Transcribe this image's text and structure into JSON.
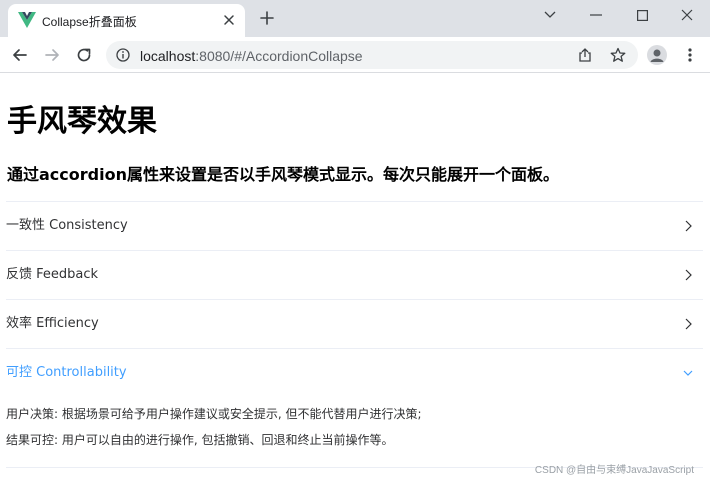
{
  "browser": {
    "tab": {
      "title": "Collapse折叠面板"
    },
    "address": {
      "host": "localhost",
      "path": ":8080/#/AccordionCollapse"
    },
    "icons": {
      "favicon": "vue-logo-icon",
      "close": "close-icon",
      "new_tab": "plus-icon",
      "back": "arrow-left-icon",
      "forward": "arrow-right-icon",
      "reload": "reload-icon",
      "info": "info-icon",
      "share": "share-icon",
      "bookmark": "star-icon",
      "profile": "person-icon",
      "menu": "kebab-menu-icon"
    }
  },
  "page": {
    "title": "手风琴效果",
    "subtitle": "通过accordion属性来设置是否以手风琴模式显示。每次只能展开一个面板。",
    "collapse": {
      "active_color": "#409eff",
      "items": [
        {
          "title": "一致性 Consistency",
          "expanded": false,
          "lines": []
        },
        {
          "title": "反馈 Feedback",
          "expanded": false,
          "lines": []
        },
        {
          "title": "效率 Efficiency",
          "expanded": false,
          "lines": []
        },
        {
          "title": "可控 Controllability",
          "expanded": true,
          "lines": [
            "用户决策: 根据场景可给予用户操作建议或安全提示, 但不能代替用户进行决策;",
            "结果可控: 用户可以自由的进行操作, 包括撤销、回退和终止当前操作等。"
          ]
        }
      ]
    }
  },
  "watermark": "CSDN @自由与束缚JavaJavaScript"
}
